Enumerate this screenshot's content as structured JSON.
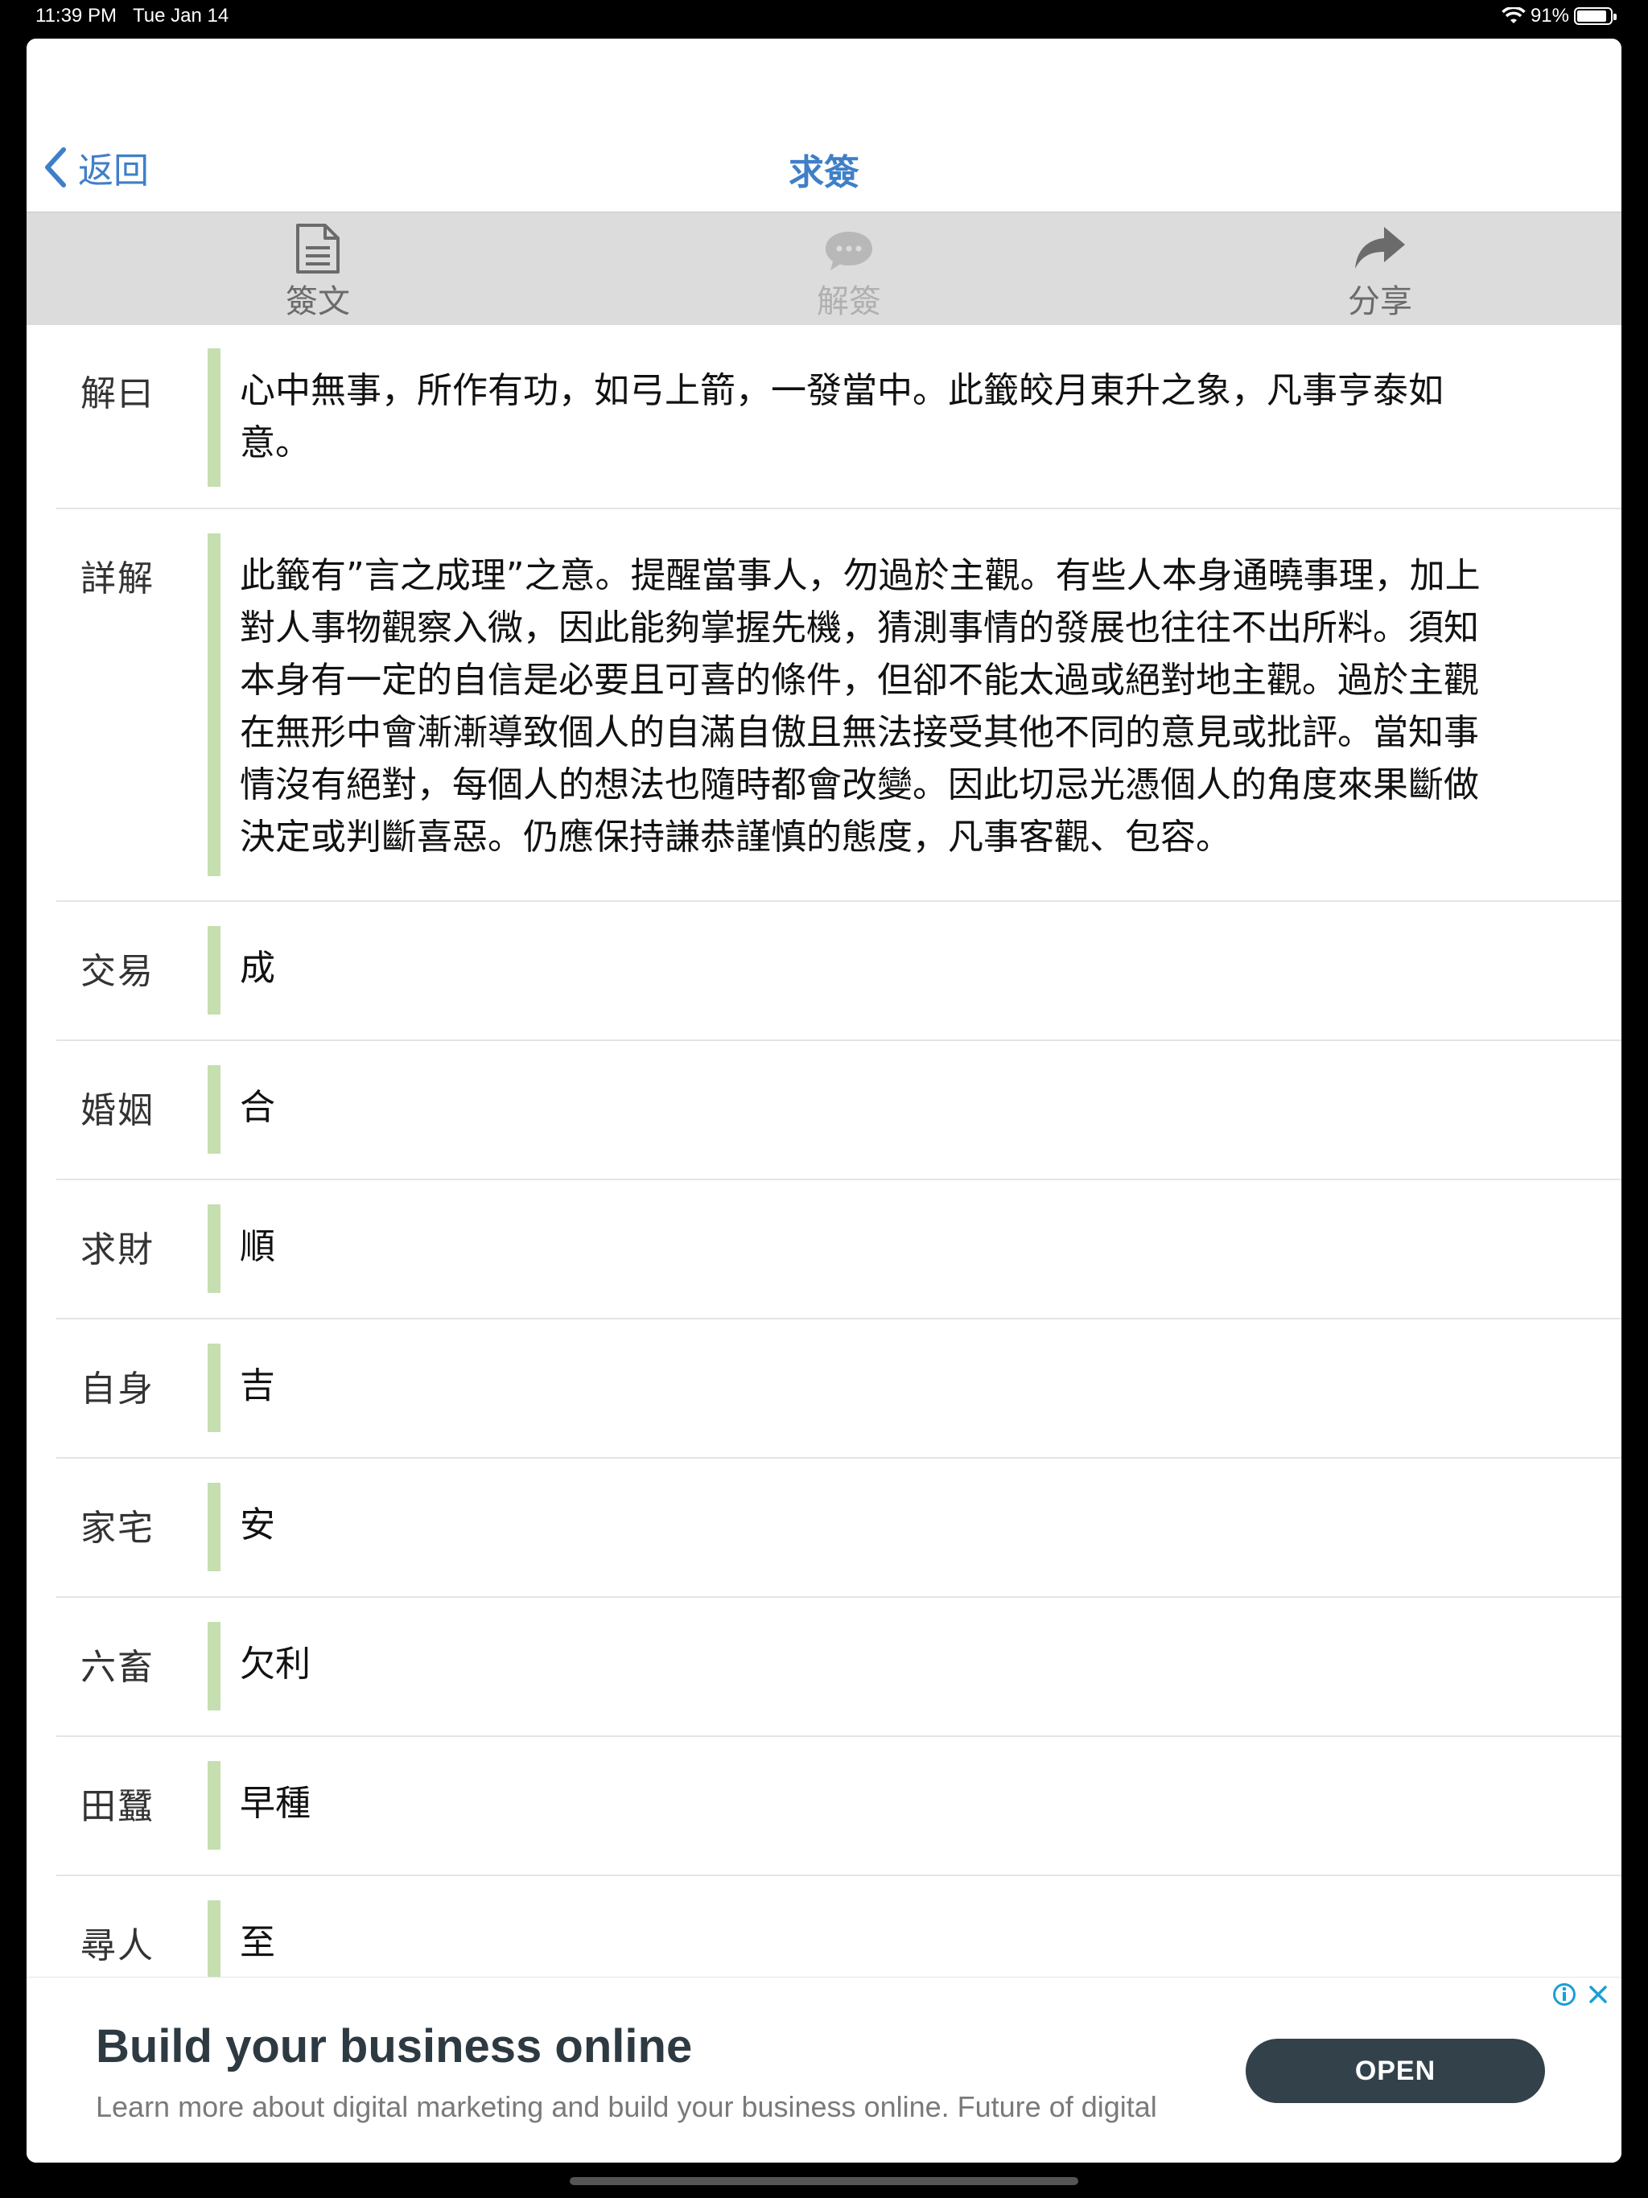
{
  "status": {
    "time": "11:39 PM",
    "date": "Tue Jan 14",
    "battery": "91%",
    "battery_level": 0.91
  },
  "nav": {
    "back_label": "返回",
    "title": "求簽"
  },
  "toolbar": {
    "items": [
      {
        "label": "簽文",
        "icon": "document-icon",
        "enabled": true
      },
      {
        "label": "解簽",
        "icon": "speech-bubble-icon",
        "enabled": false
      },
      {
        "label": "分享",
        "icon": "share-arrow-icon",
        "enabled": true
      }
    ]
  },
  "rows": [
    {
      "label": "解曰",
      "text": "心中無事，所作有功，如弓上箭，一發當中。此籤皎月東升之象，凡事亨泰如意。"
    },
    {
      "label": "詳解",
      "text": "此籤有”言之成理”之意。提醒當事人，勿過於主觀。有些人本身通曉事理，加上對人事物觀察入微，因此能夠掌握先機，猜測事情的發展也往往不出所料。須知本身有一定的自信是必要且可喜的條件，但卻不能太過或絕對地主觀。過於主觀在無形中會漸漸導致個人的自滿自傲且無法接受其他不同的意見或批評。當知事情沒有絕對，每個人的想法也隨時都會改變。因此切忌光憑個人的角度來果斷做決定或判斷喜惡。仍應保持謙恭謹慎的態度，凡事客觀、包容。"
    },
    {
      "label": "交易",
      "text": "成"
    },
    {
      "label": "婚姻",
      "text": "合"
    },
    {
      "label": "求財",
      "text": "順"
    },
    {
      "label": "自身",
      "text": "吉"
    },
    {
      "label": "家宅",
      "text": "安"
    },
    {
      "label": "六畜",
      "text": "欠利"
    },
    {
      "label": "田蠶",
      "text": "早種"
    },
    {
      "label": "尋人",
      "text": "至"
    }
  ],
  "ad": {
    "title": "Build your business online",
    "description": "Learn more about digital marketing and build your business online. Future of digital",
    "cta": "OPEN"
  },
  "colors": {
    "accent": "#3F7FC8",
    "toolbar_bg": "#dcdcdc",
    "row_bar": "#c5dfb0",
    "ad_button": "#33424a"
  }
}
